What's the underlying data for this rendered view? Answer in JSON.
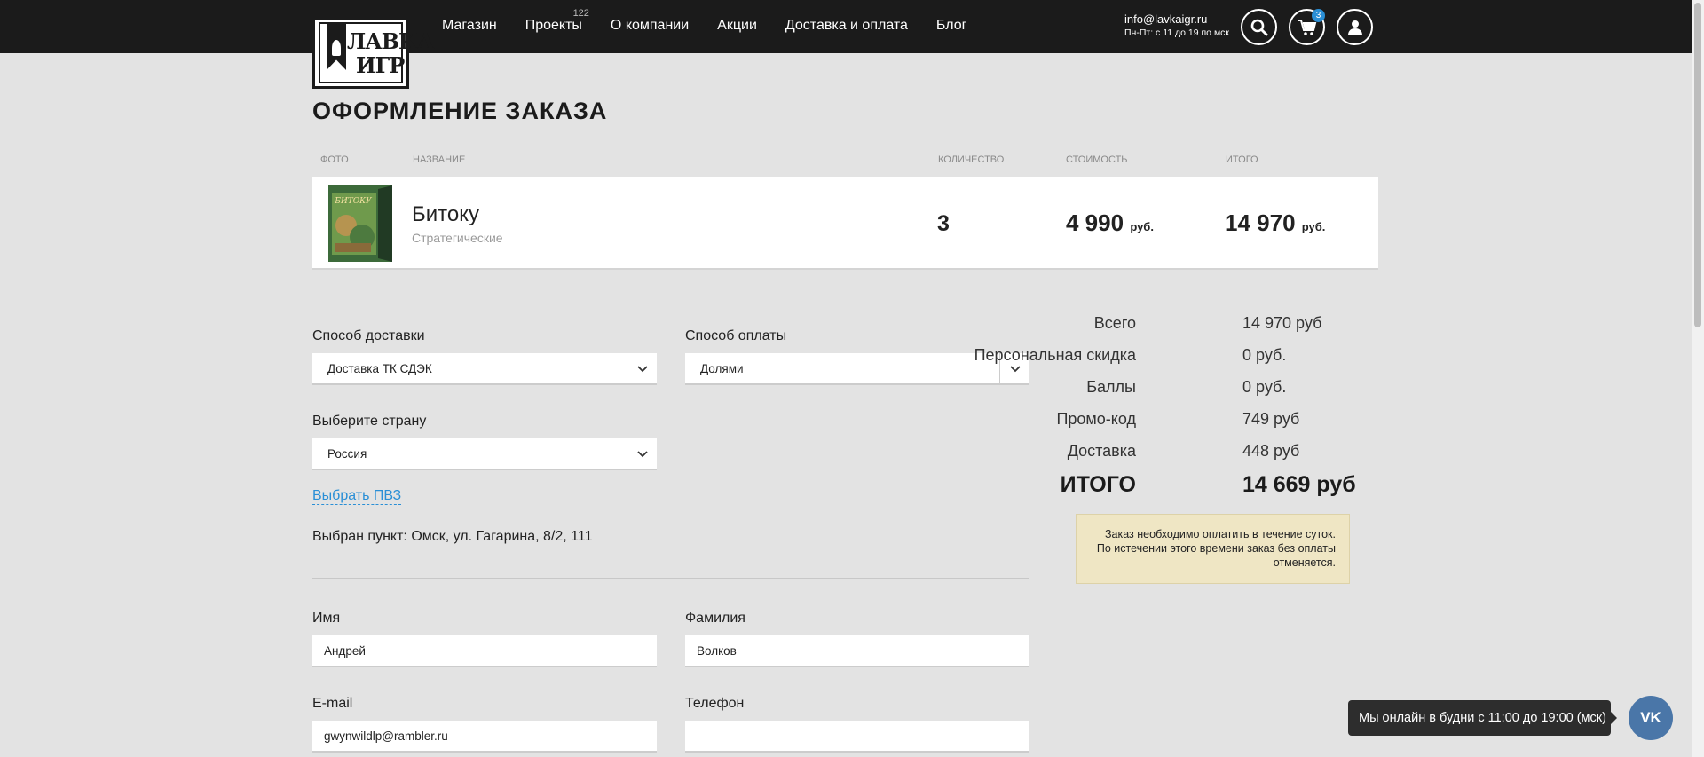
{
  "header": {
    "logo_line1": "ЛАВКА",
    "logo_line2": "ИГР",
    "nav": [
      {
        "label": "Магазин"
      },
      {
        "label": "Проекты",
        "badge": "122"
      },
      {
        "label": "О компании"
      },
      {
        "label": "Акции"
      },
      {
        "label": "Доставка и оплата"
      },
      {
        "label": "Блог"
      }
    ],
    "email": "info@lavkaigr.ru",
    "hours": "Пн-Пт: с 11 до 19 по мск",
    "cart_count": "3",
    "icons": [
      "search-icon",
      "cart-icon",
      "user-icon"
    ]
  },
  "page_title": "ОФОРМЛЕНИЕ ЗАКАЗА",
  "table": {
    "headers": [
      "ФОТО",
      "НАЗВАНИЕ",
      "КОЛИЧЕСТВО",
      "СТОИМОСТЬ",
      "ИТОГО"
    ],
    "items": [
      {
        "name": "Битоку",
        "category": "Стратегические",
        "box_text": "БИТОКУ",
        "quantity": "3",
        "price": "4 990",
        "price_unit": "руб.",
        "total": "14 970",
        "total_unit": "руб."
      }
    ]
  },
  "form": {
    "delivery_label": "Способ доставки",
    "delivery_value": "Доставка ТК СДЭК",
    "payment_label": "Способ оплаты",
    "payment_value": "Долями",
    "country_label": "Выберите страну",
    "country_value": "Россия",
    "pickup_link": "Выбрать ПВЗ",
    "chosen_point": "Выбран пункт: Омск, ул. Гагарина, 8/2, 111",
    "first_name_label": "Имя",
    "first_name_value": "Андрей",
    "last_name_label": "Фамилия",
    "last_name_value": "Волков",
    "email_label": "E-mail",
    "email_value": "gwynwildlp@rambler.ru",
    "phone_label": "Телефон",
    "phone_value": ""
  },
  "summary": {
    "rows": [
      {
        "label": "Всего",
        "value": "14 970 руб"
      },
      {
        "label": "Персональная скидка",
        "value": "0 руб."
      },
      {
        "label": "Баллы",
        "value": "0 руб."
      },
      {
        "label": "Промо-код",
        "value": "749 руб"
      },
      {
        "label": "Доставка",
        "value": "448 руб"
      }
    ],
    "total_label": "ИТОГО",
    "total_value": "14 669 руб",
    "notice": "Заказ необходимо оплатить в течение суток. По истечении этого времени заказ без оплаты отменяется."
  },
  "chat": {
    "text": "Мы онлайн в будни с 11:00 до 19:00 (мск)",
    "vk_label": "VK"
  }
}
